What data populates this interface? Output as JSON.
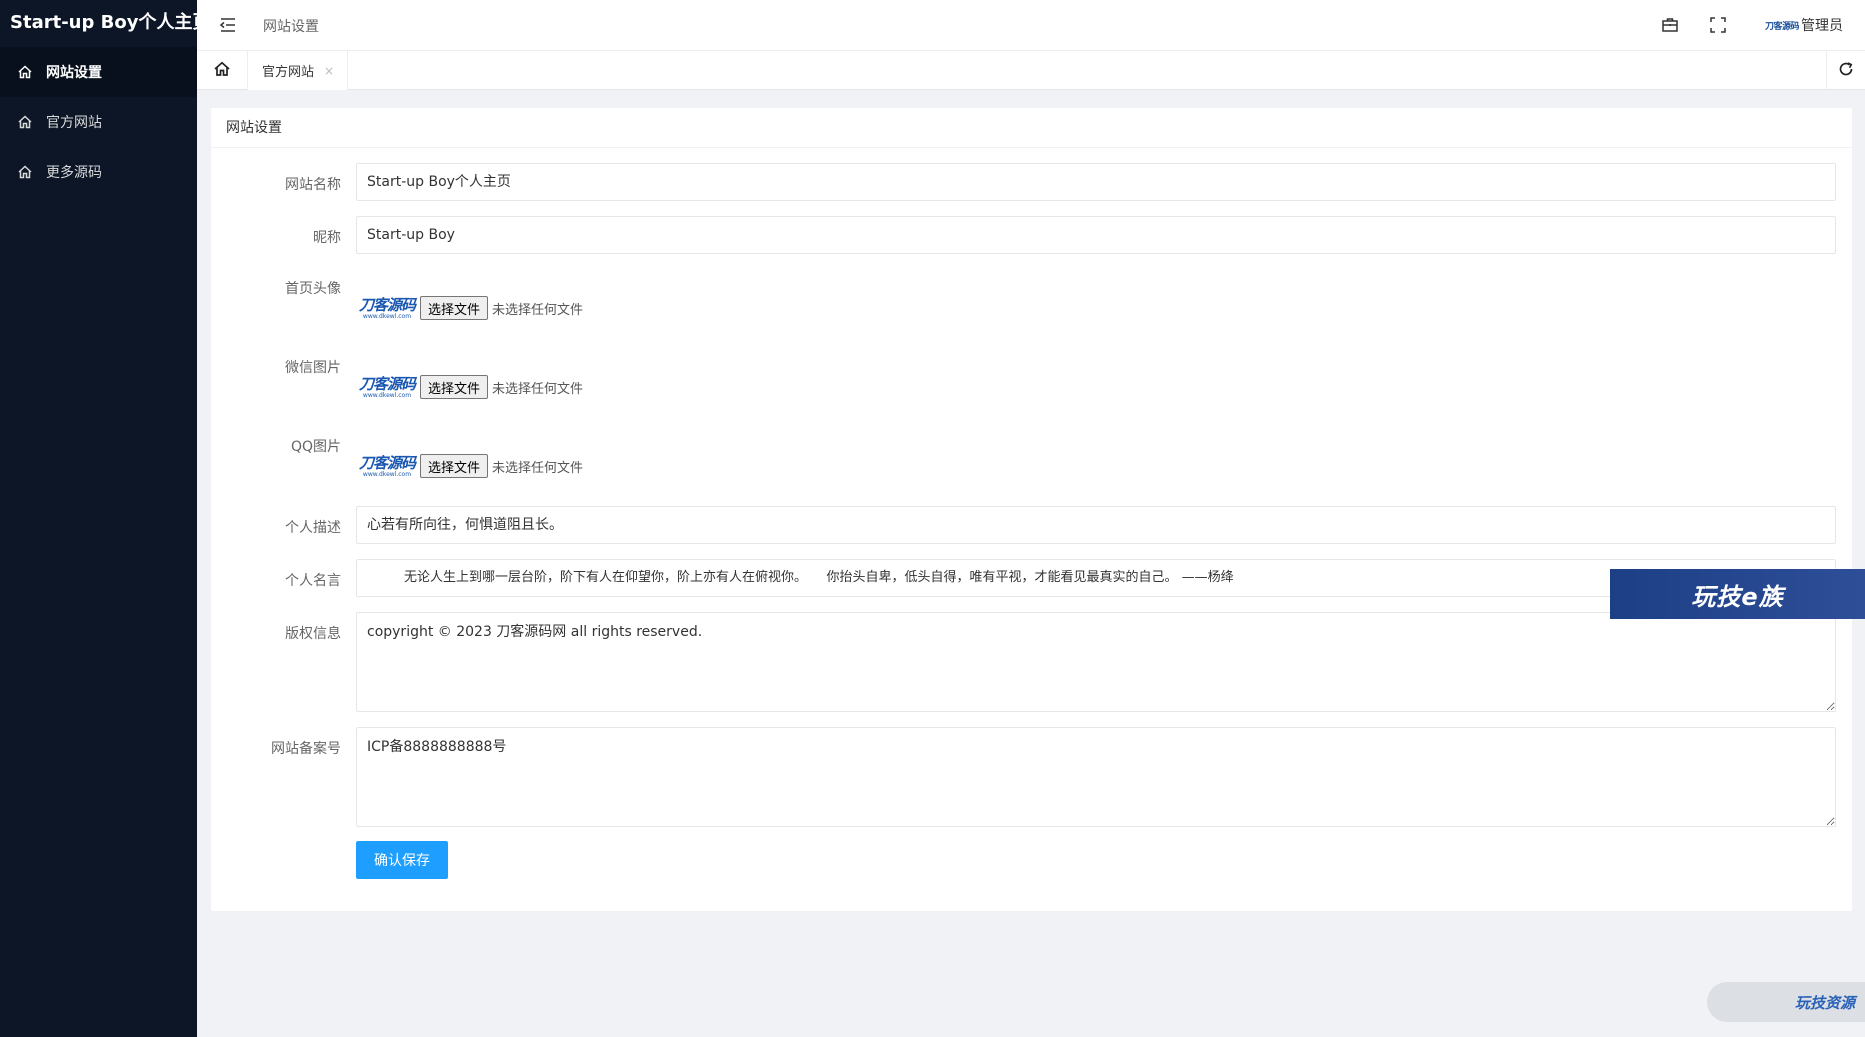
{
  "sidebar": {
    "brand": "Start-up Boy个人主页",
    "items": [
      {
        "label": "网站设置",
        "icon": "home-icon",
        "active": true
      },
      {
        "label": "官方网站",
        "icon": "home-icon",
        "active": false
      },
      {
        "label": "更多源码",
        "icon": "home-icon",
        "active": false
      }
    ]
  },
  "header": {
    "title": "网站设置",
    "admin_logo": "刀客源码",
    "admin_label": "管理员",
    "icons": [
      "menu-toggle-icon",
      "briefcase-icon",
      "fullscreen-icon"
    ]
  },
  "tabs": {
    "items": [
      {
        "label": "官方网站",
        "close": "×"
      }
    ]
  },
  "form": {
    "card_title": "网站设置",
    "site_name": {
      "label": "网站名称",
      "value": "Start-up Boy个人主页"
    },
    "nickname": {
      "label": "昵称",
      "value": "Start-up Boy"
    },
    "avatar": {
      "label": "首页头像",
      "button": "选择文件",
      "status": "未选择任何文件"
    },
    "wechat": {
      "label": "微信图片",
      "button": "选择文件",
      "status": "未选择任何文件"
    },
    "qq": {
      "label": "QQ图片",
      "button": "选择文件",
      "status": "未选择任何文件"
    },
    "thumb_text": "刀客源码",
    "thumb_sub": "www.dkewl.com",
    "description": {
      "label": "个人描述",
      "value": "心若有所向往，何惧道阻且长。"
    },
    "motto": {
      "label": "个人名言",
      "value": "无论人生上到哪一层台阶，阶下有人在仰望你，阶上亦有人在俯视你。　　你抬头自卑，低头自得，唯有平视，才能看见最真实的自己。 ——杨绛"
    },
    "copyright": {
      "label": "版权信息",
      "value": "copyright © 2023 刀客源码网 all rights reserved."
    },
    "icp": {
      "label": "网站备案号",
      "value": "ICP备8888888888号"
    },
    "save_label": "确认保存"
  },
  "watermarks": {
    "banner": "玩技e族",
    "pill": "玩技资源"
  },
  "colors": {
    "sidebar_bg": "#0c1627",
    "primary": "#1e9fff",
    "page_bg": "#f0f2f5"
  }
}
